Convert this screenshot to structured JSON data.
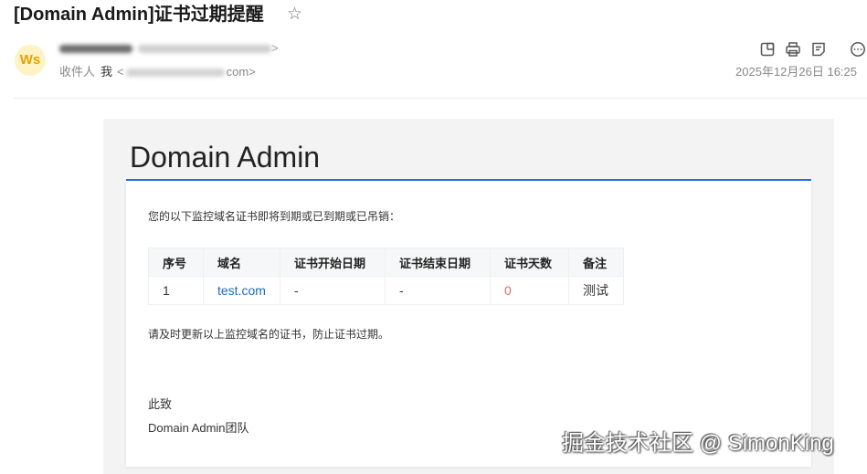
{
  "message": {
    "subject": "[Domain Admin]证书过期提醒",
    "star_icon": "star-icon",
    "star_glyph": "☆"
  },
  "header": {
    "avatar_initials": "Ws",
    "sender_close": ">",
    "recipient_label": "收件人",
    "recipient_name": "我",
    "recipient_open": "<",
    "recipient_suffix": "com>",
    "date": "2025年12月26日 16:25",
    "toolbar_icons": [
      "popout-icon",
      "print-icon",
      "note-icon",
      "more-icon"
    ]
  },
  "body": {
    "brand": "Domain Admin",
    "intro": "您的以下监控域名证书即将到期或已到期或已吊销：",
    "table": {
      "headers": [
        "序号",
        "域名",
        "证书开始日期",
        "证书结束日期",
        "证书天数",
        "备注"
      ],
      "rows": [
        [
          "1",
          "test.com",
          "-",
          "-",
          "0",
          "测试"
        ]
      ]
    },
    "reminder": "请及时更新以上监控域名的证书，防止证书过期。",
    "closing": "此致",
    "signature": "Domain Admin团队"
  },
  "watermark": "掘金技术社区 @ SimonKing",
  "colors": {
    "avatar_bg": "#fdf3c4",
    "avatar_fg": "#e3a300",
    "brand_line": "#2a6fd4",
    "link": "#1d6bbf",
    "days_alert": "#e06a6a",
    "mail_background": "#f3f3f3"
  }
}
